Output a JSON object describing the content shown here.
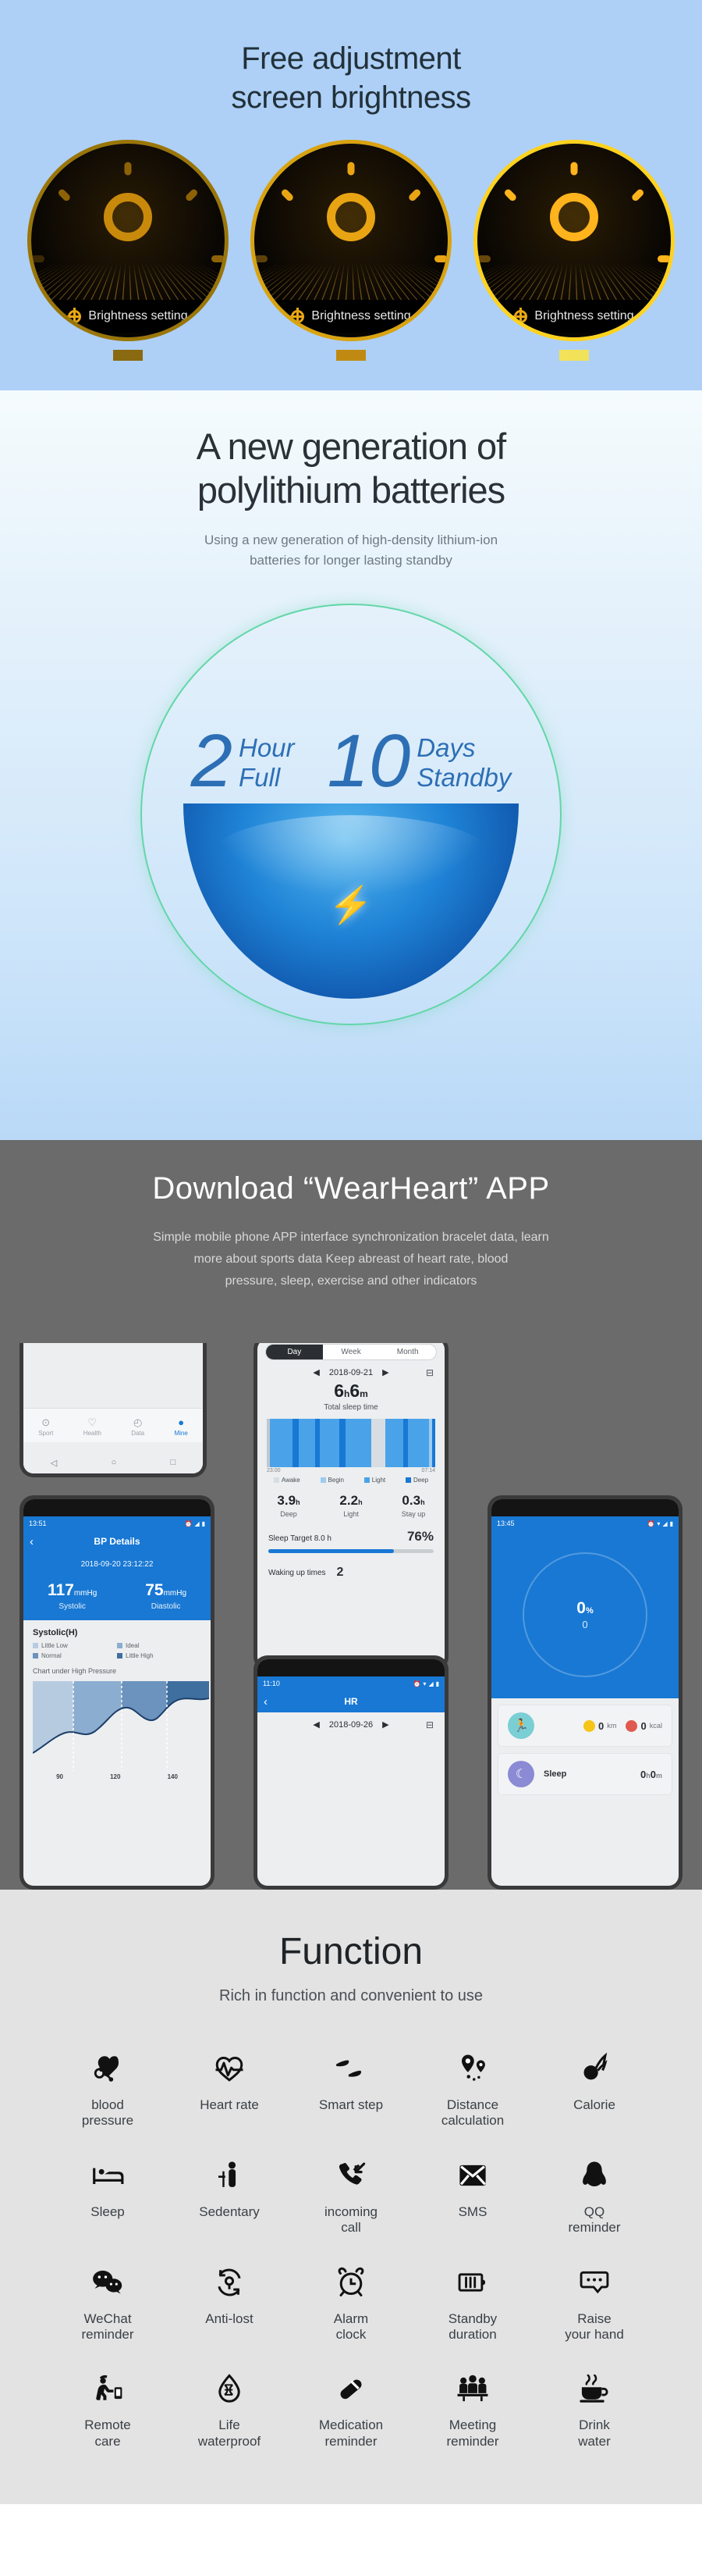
{
  "brightness": {
    "title_line1": "Free adjustment",
    "title_line2": "screen brightness",
    "watches": [
      {
        "label": "Brightness setting",
        "swatch_color": "#8a6a10",
        "ring_color": "#9a7508"
      },
      {
        "label": "Brightness setting",
        "swatch_color": "#c08a12",
        "ring_color": "#d9a310"
      },
      {
        "label": "Brightness setting",
        "swatch_color": "#f2e25a",
        "ring_color": "#ffd21e"
      }
    ]
  },
  "battery": {
    "title_line1": "A new generation of",
    "title_line2": "polylithium batteries",
    "sub_line1": "Using a new generation of high-density lithium-ion",
    "sub_line2": "batteries for longer lasting standby",
    "charge_number": "2",
    "charge_unit_line1": "Hour",
    "charge_unit_line2": "Full",
    "standby_number": "10",
    "standby_unit_line1": "Days",
    "standby_unit_line2": "Standby",
    "ring_color": "#63d6a8",
    "accent_color": "#2d6fb5"
  },
  "app": {
    "title": "Download “WearHeart” APP",
    "sub_line1": "Simple mobile phone APP interface synchronization bracelet data, learn",
    "sub_line2": "more about sports data Keep abreast of heart rate, blood",
    "sub_line3": "pressure, sleep, exercise and other indicators"
  },
  "phone_home": {
    "tabs": [
      {
        "label": "Sport",
        "icon": "sport-icon",
        "glyph": "⊙",
        "active": false
      },
      {
        "label": "Health",
        "icon": "health-icon",
        "glyph": "♡",
        "active": false
      },
      {
        "label": "Data",
        "icon": "data-icon",
        "glyph": "◴",
        "active": false
      },
      {
        "label": "Mine",
        "icon": "profile-icon",
        "glyph": "●",
        "active": true
      }
    ],
    "nav": {
      "back": "◁",
      "home": "○",
      "recents": "□"
    }
  },
  "phone_sleep": {
    "segments": [
      {
        "label": "Day",
        "active": true
      },
      {
        "label": "Week",
        "active": false
      },
      {
        "label": "Month",
        "active": false
      }
    ],
    "prev": "◀",
    "next": "▶",
    "date": "2018-09-21",
    "calendar_icon": "⊟",
    "total_value": "6",
    "total_h": "h",
    "total_m_value": "6",
    "total_m": "m",
    "total_label": "Total sleep time",
    "time_start": "23:00",
    "time_end": "07:14",
    "legend": [
      {
        "label": "Awake",
        "color": "#d7dde2"
      },
      {
        "label": "Begin",
        "color": "#9ecbf0"
      },
      {
        "label": "Light",
        "color": "#4aa3e8"
      },
      {
        "label": "Deep",
        "color": "#1878d4"
      }
    ],
    "stats": [
      {
        "value": "3.9",
        "unit": "h",
        "label": "Deep"
      },
      {
        "value": "2.2",
        "unit": "h",
        "label": "Light"
      },
      {
        "value": "0.3",
        "unit": "h",
        "label": "Stay up"
      }
    ],
    "target_label": "Sleep Target 8.0 h",
    "target_percent": "76%",
    "progress": 76,
    "wake_label": "Waking up times",
    "wake_value": "2"
  },
  "phone_hr": {
    "status_time": "11:10",
    "title": "HR",
    "back": "‹",
    "prev": "◀",
    "next": "▶",
    "date": "2018-09-26",
    "calendar_icon": "⊟"
  },
  "phone_bp": {
    "status_time": "13:51",
    "title": "BP Details",
    "back": "‹",
    "timestamp": "2018-09-20 23:12:22",
    "systolic_value": "117",
    "systolic_unit": "mmHg",
    "systolic_label": "Systolic",
    "diastolic_value": "75",
    "diastolic_unit": "mmHg",
    "diastolic_label": "Diastolic",
    "chart_title": "Systolic(H)",
    "chart_legend": [
      {
        "label": "Little Low",
        "color": "#b7cbe0"
      },
      {
        "label": "Ideal",
        "color": "#8badd0"
      },
      {
        "label": "Normal",
        "color": "#6b93bd"
      },
      {
        "label": "Little High",
        "color": "#3f6f9f"
      }
    ],
    "chart_note": "Chart under High Pressure",
    "chart_ticks": [
      "90",
      "120",
      "140"
    ]
  },
  "phone_dash": {
    "status_time": "13:45",
    "percent_value": "0",
    "percent_sign": "%",
    "steps": "0",
    "distance_value": "0",
    "distance_unit": "km",
    "distance_color": "#f5c518",
    "calorie_value": "0",
    "calorie_unit": "kcal",
    "calorie_color": "#e05a4f",
    "sleep_label": "Sleep",
    "sleep_value_h": "0",
    "sleep_h": "h",
    "sleep_value_m": "0",
    "sleep_m": "m",
    "sleep_color": "#8b8ad4",
    "run_icon": "run-icon"
  },
  "chart_data": [
    {
      "type": "bar",
      "title": "Sleep hypnogram",
      "xlabel": "",
      "ylabel": "",
      "x": [
        "23:00",
        "07:14"
      ],
      "categories": [
        "awake",
        "begin",
        "light",
        "deep"
      ],
      "series": [
        {
          "name": "Deep",
          "values": [
            3.9
          ]
        },
        {
          "name": "Light",
          "values": [
            2.2
          ]
        },
        {
          "name": "Stay up",
          "values": [
            0.3
          ]
        }
      ],
      "legend_position": "bottom",
      "grid": false,
      "annotations": [
        "6h6m Total sleep time",
        "Sleep Target 8.0 h",
        "76%",
        "Waking up times 2"
      ]
    },
    {
      "type": "area",
      "title": "Systolic(H)",
      "xlabel": "",
      "ylabel": "",
      "tick_labels": [
        "90",
        "120",
        "140"
      ],
      "xlim": [
        70,
        160
      ],
      "values": [
        86,
        92,
        95,
        104,
        112,
        108,
        118,
        124,
        120,
        130,
        134
      ],
      "legend": [
        "Little Low",
        "Ideal",
        "Normal",
        "Little High"
      ],
      "legend_position": "top",
      "grid": false,
      "annotations": [
        "Chart under High Pressure",
        "117mmHg Systolic",
        "75mmHg Diastolic"
      ]
    }
  ],
  "function": {
    "title": "Function",
    "sub": "Rich in function and convenient to use",
    "items": [
      {
        "icon": "blood-pressure-icon",
        "label": "blood\npressure"
      },
      {
        "icon": "heart-rate-icon",
        "label": "Heart rate"
      },
      {
        "icon": "smart-step-icon",
        "label": "Smart step"
      },
      {
        "icon": "distance-icon",
        "label": "Distance\ncalculation"
      },
      {
        "icon": "calorie-icon",
        "label": "Calorie"
      },
      {
        "icon": "sleep-icon",
        "label": "Sleep"
      },
      {
        "icon": "sedentary-icon",
        "label": "Sedentary"
      },
      {
        "icon": "incoming-call-icon",
        "label": "incoming\ncall"
      },
      {
        "icon": "sms-icon",
        "label": "SMS"
      },
      {
        "icon": "qq-icon",
        "label": "QQ\nreminder"
      },
      {
        "icon": "wechat-icon",
        "label": "WeChat\nreminder"
      },
      {
        "icon": "anti-lost-icon",
        "label": "Anti-lost"
      },
      {
        "icon": "alarm-clock-icon",
        "label": "Alarm\nclock"
      },
      {
        "icon": "standby-icon",
        "label": "Standby\nduration"
      },
      {
        "icon": "raise-hand-icon",
        "label": "Raise\nyour hand"
      },
      {
        "icon": "remote-care-icon",
        "label": "Remote\ncare"
      },
      {
        "icon": "waterproof-icon",
        "label": "Life\nwaterproof"
      },
      {
        "icon": "medication-icon",
        "label": "Medication\nreminder"
      },
      {
        "icon": "meeting-icon",
        "label": "Meeting\nreminder"
      },
      {
        "icon": "drink-water-icon",
        "label": "Drink\nwater"
      }
    ]
  }
}
